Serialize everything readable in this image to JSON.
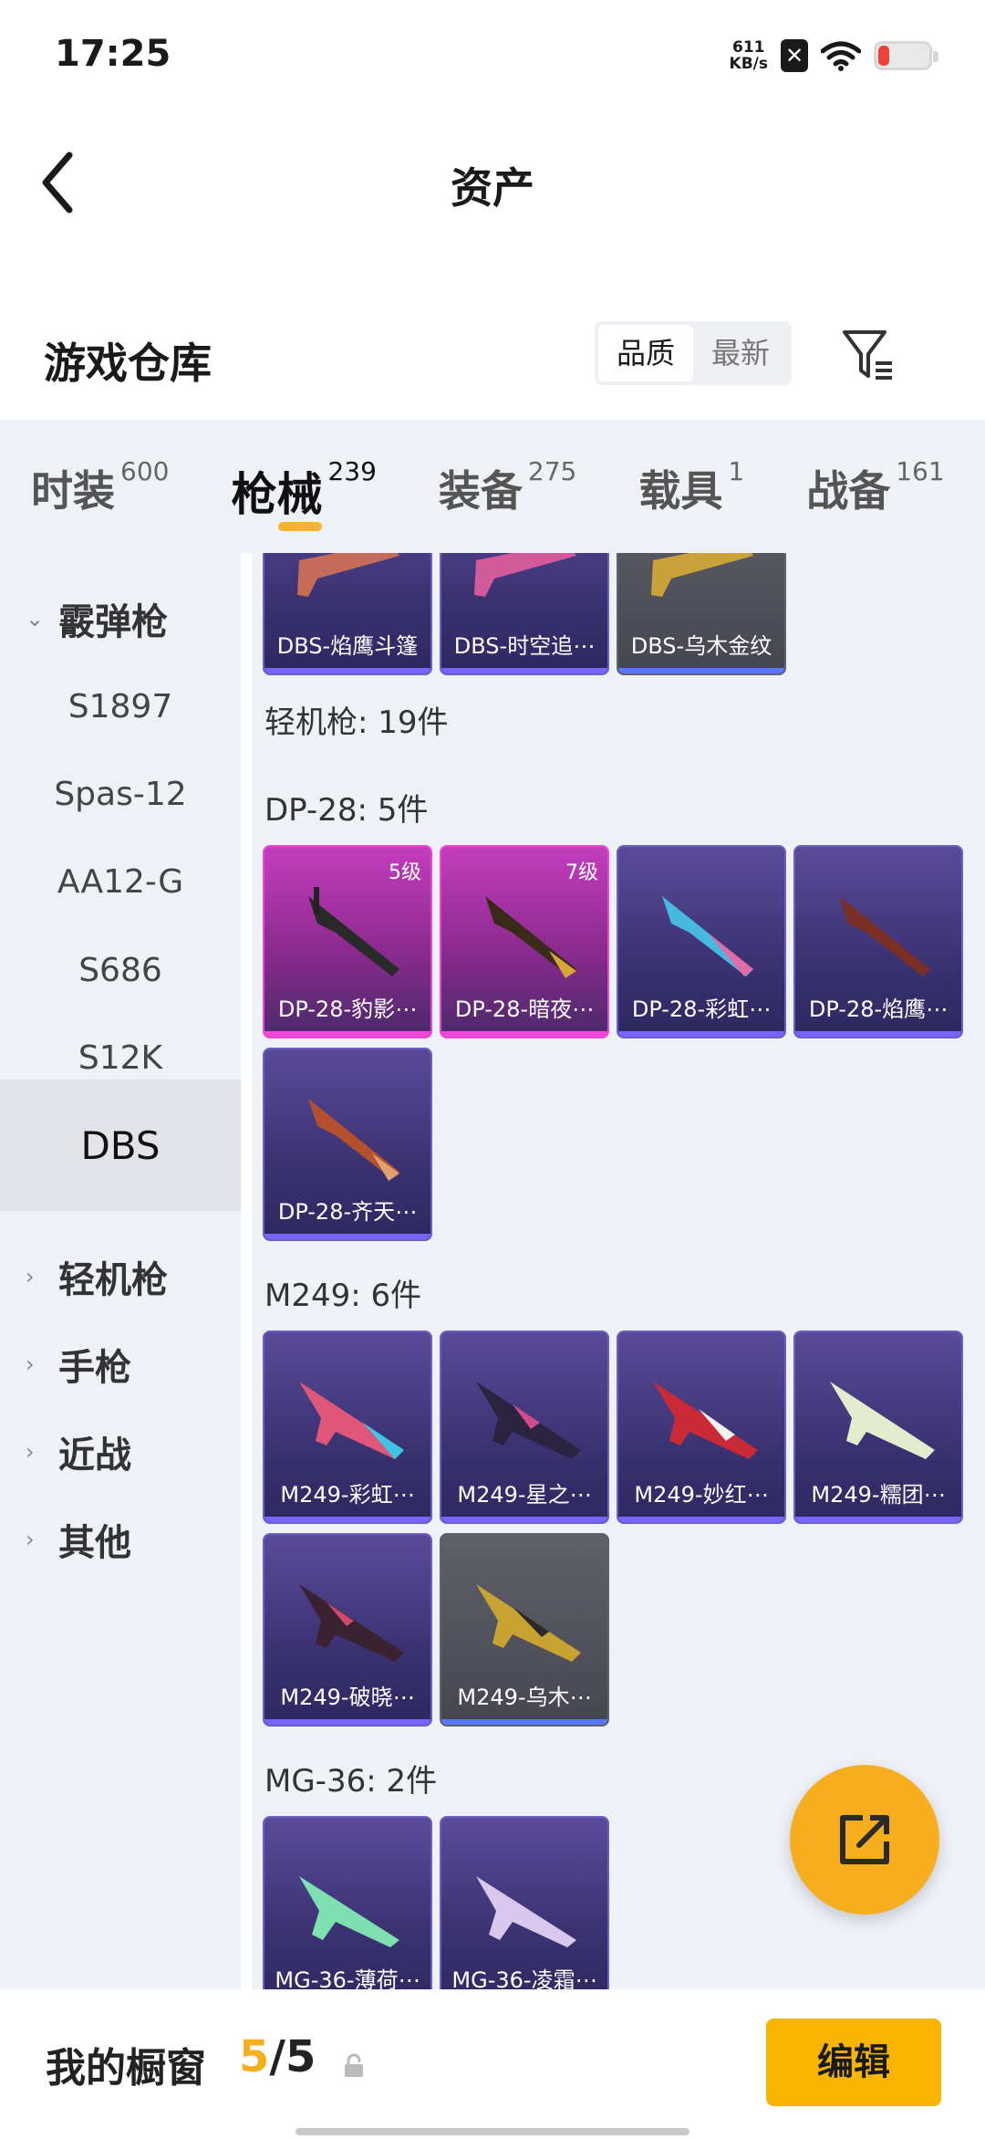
{
  "status": {
    "time": "17:25",
    "net_speed_value": "611",
    "net_speed_unit": "KB/s",
    "battery_percent": 20
  },
  "nav": {
    "title": "资产"
  },
  "warehouse": {
    "title": "游戏仓库",
    "sort_options": [
      "品质",
      "最新"
    ],
    "sort_selected": "品质"
  },
  "tabs": [
    {
      "label": "时装",
      "count": "600"
    },
    {
      "label": "枪械",
      "count": "239",
      "active": true
    },
    {
      "label": "装备",
      "count": "275"
    },
    {
      "label": "载具",
      "count": "1"
    },
    {
      "label": "战备",
      "count": "161"
    }
  ],
  "sidebar": {
    "items": [
      {
        "label": "霰弹枪",
        "type": "group-open"
      },
      {
        "label": "S1897",
        "type": "sub"
      },
      {
        "label": "Spas-12",
        "type": "sub"
      },
      {
        "label": "AA12-G",
        "type": "sub"
      },
      {
        "label": "S686",
        "type": "sub"
      },
      {
        "label": "S12K",
        "type": "sub"
      },
      {
        "label": "DBS",
        "type": "sub",
        "selected": true
      },
      {
        "label": "轻机枪",
        "type": "group"
      },
      {
        "label": "手枪",
        "type": "group"
      },
      {
        "label": "近战",
        "type": "group"
      },
      {
        "label": "其他",
        "type": "group"
      }
    ]
  },
  "content": {
    "dbs_items": [
      {
        "label": "DBS-焰鹰斗篷",
        "rarity": "purple"
      },
      {
        "label": "DBS-时空追⋯",
        "rarity": "purple"
      },
      {
        "label": "DBS-乌木金纹",
        "rarity": "gray"
      }
    ],
    "lmg_title": "轻机枪: 19件",
    "dp28_title": "DP-28: 5件",
    "dp28_items": [
      {
        "label": "DP-28-豹影⋯",
        "rarity": "pink",
        "level": "5级"
      },
      {
        "label": "DP-28-暗夜⋯",
        "rarity": "pink",
        "level": "7级"
      },
      {
        "label": "DP-28-彩虹⋯",
        "rarity": "purple"
      },
      {
        "label": "DP-28-焰鹰⋯",
        "rarity": "purple"
      },
      {
        "label": "DP-28-齐天⋯",
        "rarity": "purple"
      }
    ],
    "m249_title": "M249: 6件",
    "m249_items": [
      {
        "label": "M249-彩虹⋯",
        "rarity": "purple"
      },
      {
        "label": "M249-星之⋯",
        "rarity": "purple"
      },
      {
        "label": "M249-妙红⋯",
        "rarity": "purple"
      },
      {
        "label": "M249-糯团⋯",
        "rarity": "purple"
      },
      {
        "label": "M249-破晓⋯",
        "rarity": "purple"
      },
      {
        "label": "M249-乌木⋯",
        "rarity": "gray"
      }
    ],
    "mg36_title": "MG-36: 2件",
    "mg36_items": [
      {
        "label": "MG-36-薄荷⋯",
        "rarity": "purple"
      },
      {
        "label": "MG-36-凌霜⋯",
        "rarity": "purple"
      }
    ]
  },
  "bottom": {
    "title": "我的橱窗",
    "count_current": "5",
    "count_sep": "/",
    "count_total": "5",
    "edit_label": "编辑"
  },
  "colors": {
    "accent": "#f7ae1e",
    "rarity_purple": "#6e5fc2",
    "rarity_pink": "#ea49d8",
    "rarity_gray": "#60616a"
  }
}
